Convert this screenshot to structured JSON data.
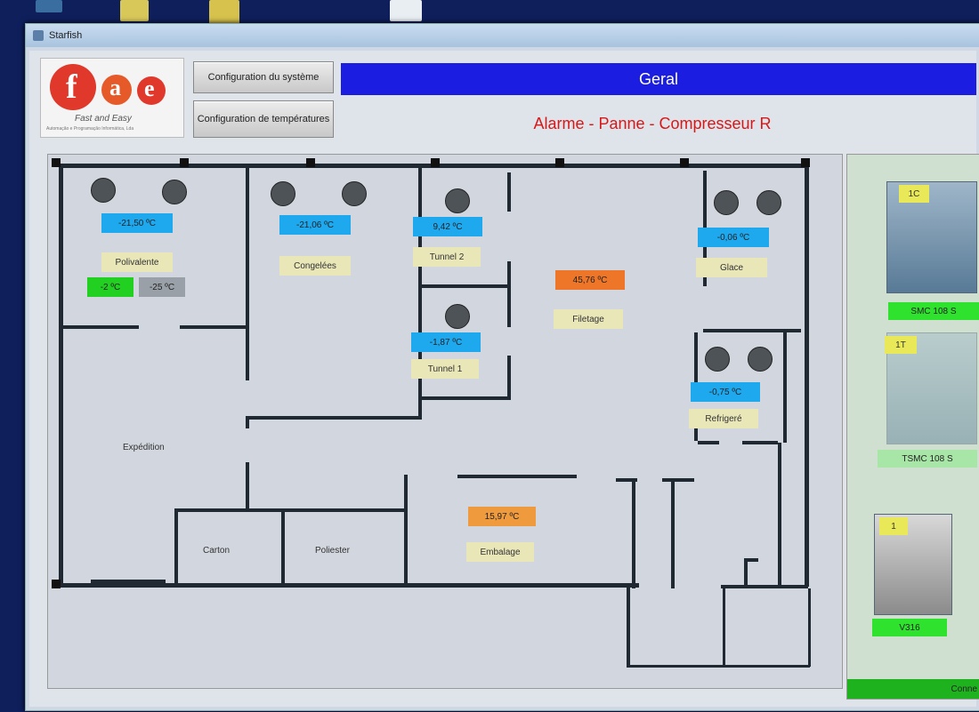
{
  "window": {
    "title": "Starfish"
  },
  "logo": {
    "mark_f": "f",
    "mark_a": "a",
    "mark_e": "e",
    "tagline": "Fast and Easy",
    "subtagline": "Automação e Programação Informática, Lda"
  },
  "toolbar": {
    "config_system": "Configuration du système",
    "config_temps": "Configuration de températures"
  },
  "banner": {
    "title": "Geral"
  },
  "alarm": {
    "text": "Alarme - Panne - Compresseur R"
  },
  "rooms": {
    "polivalente": {
      "temp": "-21,50 ºC",
      "label": "Polivalente",
      "setpoint_1": "-2 ºC",
      "setpoint_2": "-25 ºC"
    },
    "congelees": {
      "temp": "-21,06 ºC",
      "label": "Congelées"
    },
    "tunnel2": {
      "temp": "9,42 ºC",
      "label": "Tunnel 2"
    },
    "tunnel1": {
      "temp": "-1,87 ºC",
      "label": "Tunnel 1"
    },
    "filetage": {
      "temp": "45,76 ºC",
      "label": "Filetage"
    },
    "glace": {
      "temp": "-0,06 ºC",
      "label": "Glace"
    },
    "refrigere": {
      "temp": "-0,75 ºC",
      "label": "Refrigeré"
    },
    "embalage": {
      "temp": "15,97 ºC",
      "label": "Embalage"
    },
    "expedition": {
      "label": "Expédition"
    },
    "carton": {
      "label": "Carton"
    },
    "poliester": {
      "label": "Poliester"
    }
  },
  "compressors": [
    {
      "badge": "1C",
      "name": "SMC 108 S"
    },
    {
      "badge": "1T",
      "name": "TSMC 108 S"
    },
    {
      "badge": "1",
      "name": "V316"
    }
  ],
  "footer": {
    "connect": "Conne"
  },
  "colors": {
    "banner": "#1b1ee0",
    "alarm": "#d81818",
    "temp_cold": "#1ea9ef",
    "temp_hot": "#ee7628",
    "ok": "#2ee22e"
  }
}
